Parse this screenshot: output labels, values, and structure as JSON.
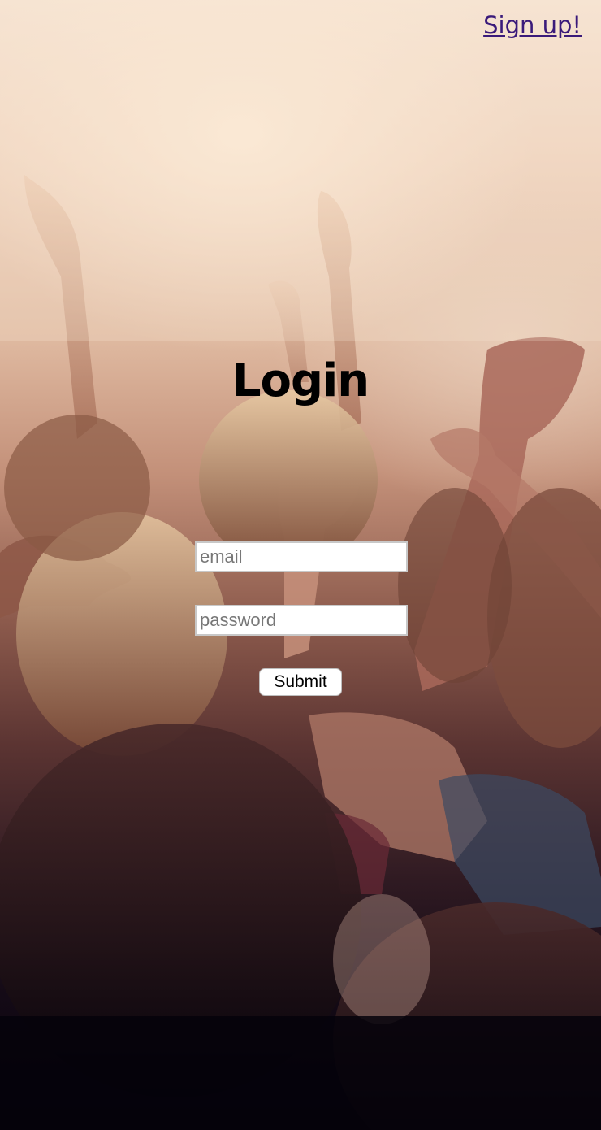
{
  "header": {
    "signup_label": "Sign up!"
  },
  "login": {
    "title": "Login",
    "email_placeholder": "email",
    "email_value": "",
    "password_placeholder": "password",
    "password_value": "",
    "submit_label": "Submit"
  },
  "colors": {
    "link": "#3a1a7a",
    "title": "#000000",
    "field_border": "#c8c8c8"
  },
  "background": {
    "icon": "concert-crowd-photo"
  }
}
